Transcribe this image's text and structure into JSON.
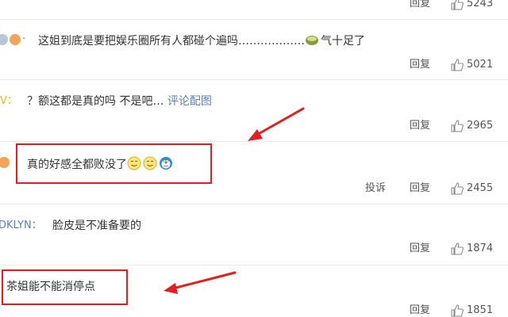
{
  "comments": [
    {
      "username_fragment": "",
      "text": "",
      "reply_label": "回复",
      "likes": "5243"
    },
    {
      "username_fragment": "·",
      "text": "这姐到底是要把娱乐圈所有人都碰个遍吗………………",
      "text_suffix": "气十足了",
      "reply_label": "回复",
      "likes": "5021"
    },
    {
      "username_fragment": "V：",
      "text": "？额这都是真的吗 不是吧…",
      "link_text": "评论配图",
      "reply_label": "回复",
      "likes": "2965"
    },
    {
      "username_fragment": "",
      "text": "真的好感全都败没了",
      "report_label": "投诉",
      "reply_label": "回复",
      "likes": "2455"
    },
    {
      "username_fragment": "DKLYN：",
      "text": "脸皮是不准备要的",
      "reply_label": "回复",
      "likes": "1874"
    },
    {
      "username_fragment": "",
      "text": "茶姐能不能消停点",
      "reply_label": "回复",
      "likes": "1851"
    }
  ],
  "colors": {
    "highlight": "#e41e1e",
    "link": "#5a80b5",
    "username": "#eb7350",
    "divider": "#e8e8e8"
  },
  "icons": [
    "thumbs-up-icon",
    "matcha-emoji-icon",
    "smile-emoji-icon",
    "doraemon-emoji-icon",
    "red-arrow-annotation"
  ]
}
